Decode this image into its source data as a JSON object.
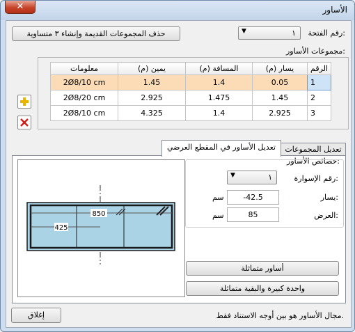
{
  "window": {
    "title": "الأساور",
    "close_label": "✕"
  },
  "top": {
    "opening_label": "رقم الفتحة:",
    "opening_value": "١",
    "delete_button": "حذف المجموعات القديمة وإنشاء ٣ متساوية",
    "groups_label": "مجموعات الأساور:"
  },
  "table": {
    "headers": [
      "الرقم",
      "يسار (م)",
      "المسافة (م)",
      "يمين (م)",
      "معلومات"
    ],
    "rows": [
      {
        "num": "1",
        "left": "0.05",
        "distance": "1.4",
        "right": "1.45",
        "info": "2Ø8/10 cm"
      },
      {
        "num": "2",
        "left": "1.45",
        "distance": "1.475",
        "right": "2.925",
        "info": "2Ø8/20 cm"
      },
      {
        "num": "3",
        "left": "2.925",
        "distance": "1.4",
        "right": "4.325",
        "info": "2Ø8/10 cm"
      }
    ]
  },
  "tabs": {
    "groups": "تعديل المجموعات",
    "section": "تعديل الأساور في المقطع العرضي"
  },
  "props": {
    "legend": "خصائص الأساور:",
    "stirrup_no_label": "رقم الإسوارة:",
    "stirrup_no_value": "١",
    "left_label": "يسار:",
    "left_value": "-42.5",
    "left_unit": "سم",
    "width_label": "العرض:",
    "width_value": "85",
    "width_unit": "سم"
  },
  "buttons": {
    "symmetric": "أساور متماثلة",
    "one_big": "واحدة كبيرة والبقية متماثلة",
    "close": "إغلاق"
  },
  "drawing": {
    "dim_width": "850",
    "dim_left": "425"
  },
  "status": {
    "text": "مجال الأساور هو بين أوجه الاستناد فقط."
  },
  "colors": {
    "selected_row": "#fbdcb6",
    "section_fill": "#aad3e6",
    "accent_plus": "#e8b400",
    "accent_x": "#d0201a"
  },
  "icons": {
    "add": "plus-icon",
    "remove": "x-icon"
  }
}
